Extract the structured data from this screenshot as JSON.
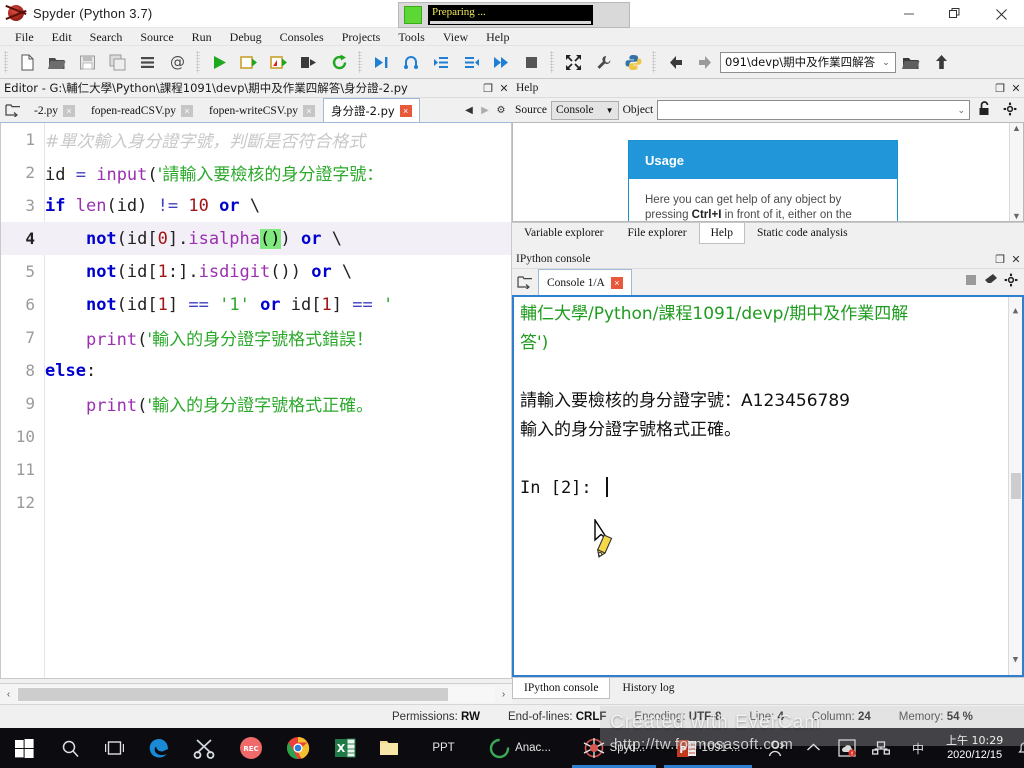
{
  "window": {
    "title": "Spyder (Python 3.7)",
    "app_icon": "spyder-logo-icon",
    "minimize": "—",
    "maximize": "❐",
    "close": "✕",
    "progress_widget": {
      "label": "Preparing ...",
      "indicator_color": "#5cd733"
    }
  },
  "menubar": {
    "items": [
      {
        "label": "File"
      },
      {
        "label": "Edit"
      },
      {
        "label": "Search"
      },
      {
        "label": "Source"
      },
      {
        "label": "Run"
      },
      {
        "label": "Debug"
      },
      {
        "label": "Consoles"
      },
      {
        "label": "Projects"
      },
      {
        "label": "Tools"
      },
      {
        "label": "View"
      },
      {
        "label": "Help"
      }
    ]
  },
  "toolbar": {
    "path_combo": {
      "value": "091\\devp\\期中及作業四解答",
      "arrow": "⌄"
    },
    "buttons": [
      {
        "name": "new-file-button",
        "icon": "new-file-icon"
      },
      {
        "name": "open-file-button",
        "icon": "open-folder-icon"
      },
      {
        "name": "save-file-button",
        "icon": "save-disk-icon"
      },
      {
        "name": "save-all-button",
        "icon": "save-all-icon"
      },
      {
        "name": "file-switcher-button",
        "icon": "list-icon"
      },
      {
        "name": "find-symbol-button",
        "icon": "at-sign-icon"
      },
      {
        "name": "run-file-button",
        "icon": "run-play-icon"
      },
      {
        "name": "run-cell-button",
        "icon": "run-cell-icon"
      },
      {
        "name": "run-cell-advance-button",
        "icon": "run-cell-advance-icon"
      },
      {
        "name": "run-selection-button",
        "icon": "run-selection-icon"
      },
      {
        "name": "restart-kernel-button",
        "icon": "restart-circle-icon"
      },
      {
        "name": "debug-file-button",
        "icon": "debug-step-icon"
      },
      {
        "name": "debug-step-button",
        "icon": "debug-into-icon"
      },
      {
        "name": "debug-step-over-button",
        "icon": "debug-over-icon"
      },
      {
        "name": "debug-step-return-button",
        "icon": "debug-return-icon"
      },
      {
        "name": "debug-continue-button",
        "icon": "debug-continue-icon"
      },
      {
        "name": "debug-stop-button",
        "icon": "debug-stop-icon"
      },
      {
        "name": "maximize-pane-button",
        "icon": "expand-arrows-icon"
      },
      {
        "name": "preferences-button",
        "icon": "wrench-icon"
      },
      {
        "name": "pythonpath-button",
        "icon": "python-logo-icon"
      },
      {
        "name": "back-button",
        "icon": "arrow-left-icon"
      },
      {
        "name": "forward-button",
        "icon": "arrow-right-icon"
      },
      {
        "name": "browse-dir-button",
        "icon": "open-folder-icon"
      },
      {
        "name": "parent-dir-button",
        "icon": "arrow-up-icon"
      }
    ]
  },
  "editor": {
    "pane_title": "Editor - G:\\輔仁大學\\Python\\課程1091\\devp\\期中及作業四解答\\身分證-2.py",
    "undock_glyph": "❐",
    "close_glyph": "✕",
    "tabs": [
      {
        "label": "-2.py",
        "active": false
      },
      {
        "label": "fopen-readCSV.py",
        "active": false
      },
      {
        "label": "fopen-writeCSV.py",
        "active": false
      },
      {
        "label": "身分證-2.py",
        "active": true
      }
    ],
    "tab_nav": {
      "prev": "◀",
      "next": "▶",
      "options": "⚙"
    },
    "current_line": 4,
    "lines": [
      {
        "no": "1",
        "tokens": [
          {
            "t": "#單次輸入身分證字號，判斷是否符合格式",
            "c": "comment"
          }
        ]
      },
      {
        "no": "2",
        "tokens": [
          {
            "t": "id ",
            "c": "plain"
          },
          {
            "t": "=",
            "c": "op"
          },
          {
            "t": " ",
            "c": "plain"
          },
          {
            "t": "input",
            "c": "bi"
          },
          {
            "t": "(",
            "c": "plain"
          },
          {
            "t": "'請輸入要檢核的身分證字號：",
            "c": "str"
          }
        ]
      },
      {
        "no": "3",
        "tokens": [
          {
            "t": "if",
            "c": "kw"
          },
          {
            "t": " ",
            "c": "plain"
          },
          {
            "t": "len",
            "c": "bi"
          },
          {
            "t": "(id) ",
            "c": "plain"
          },
          {
            "t": "!=",
            "c": "op"
          },
          {
            "t": " ",
            "c": "plain"
          },
          {
            "t": "10",
            "c": "num"
          },
          {
            "t": " ",
            "c": "plain"
          },
          {
            "t": "or",
            "c": "kw"
          },
          {
            "t": " \\",
            "c": "plain"
          }
        ]
      },
      {
        "no": "4",
        "tokens": [
          {
            "t": "    ",
            "c": "plain"
          },
          {
            "t": "not",
            "c": "kw"
          },
          {
            "t": "(id[",
            "c": "plain"
          },
          {
            "t": "0",
            "c": "num"
          },
          {
            "t": "].",
            "c": "plain"
          },
          {
            "t": "isalpha",
            "c": "bi"
          },
          {
            "t": "()",
            "c": "match"
          },
          {
            "t": ") ",
            "c": "plain"
          },
          {
            "t": "or",
            "c": "kw"
          },
          {
            "t": " \\",
            "c": "plain"
          }
        ]
      },
      {
        "no": "5",
        "tokens": [
          {
            "t": "    ",
            "c": "plain"
          },
          {
            "t": "not",
            "c": "kw"
          },
          {
            "t": "(id[",
            "c": "plain"
          },
          {
            "t": "1",
            "c": "num"
          },
          {
            "t": ":].",
            "c": "plain"
          },
          {
            "t": "isdigit",
            "c": "bi"
          },
          {
            "t": "()) ",
            "c": "plain"
          },
          {
            "t": "or",
            "c": "kw"
          },
          {
            "t": " \\",
            "c": "plain"
          }
        ]
      },
      {
        "no": "6",
        "tokens": [
          {
            "t": "    ",
            "c": "plain"
          },
          {
            "t": "not",
            "c": "kw"
          },
          {
            "t": "(id[",
            "c": "plain"
          },
          {
            "t": "1",
            "c": "num"
          },
          {
            "t": "] ",
            "c": "plain"
          },
          {
            "t": "==",
            "c": "op"
          },
          {
            "t": " ",
            "c": "plain"
          },
          {
            "t": "'1'",
            "c": "str"
          },
          {
            "t": " ",
            "c": "plain"
          },
          {
            "t": "or",
            "c": "kw"
          },
          {
            "t": " id[",
            "c": "plain"
          },
          {
            "t": "1",
            "c": "num"
          },
          {
            "t": "] ",
            "c": "plain"
          },
          {
            "t": "==",
            "c": "op"
          },
          {
            "t": " ",
            "c": "plain"
          },
          {
            "t": "'",
            "c": "str"
          }
        ]
      },
      {
        "no": "7",
        "tokens": [
          {
            "t": "    ",
            "c": "plain"
          },
          {
            "t": "print",
            "c": "bi"
          },
          {
            "t": "(",
            "c": "plain"
          },
          {
            "t": "'輸入的身分證字號格式錯誤！",
            "c": "str"
          }
        ]
      },
      {
        "no": "8",
        "tokens": [
          {
            "t": "else",
            "c": "kw"
          },
          {
            "t": ":",
            "c": "plain"
          }
        ]
      },
      {
        "no": "9",
        "tokens": [
          {
            "t": "    ",
            "c": "plain"
          },
          {
            "t": "print",
            "c": "bi"
          },
          {
            "t": "(",
            "c": "plain"
          },
          {
            "t": "'輸入的身分證字號格式正確。",
            "c": "str"
          }
        ]
      },
      {
        "no": "10",
        "tokens": []
      },
      {
        "no": "11",
        "tokens": []
      },
      {
        "no": "12",
        "tokens": []
      }
    ],
    "hscroll": {
      "left_arrow": "‹",
      "right_arrow": "›"
    }
  },
  "help": {
    "pane_title": "Help",
    "undock_glyph": "❐",
    "close_glyph": "✕",
    "source_label": "Source",
    "source_value": "Console",
    "source_arrow": "▼",
    "object_label": "Object",
    "object_value": "",
    "object_arrow": "⌄",
    "lock_icon": "unlock-icon",
    "options_icon": "gear-icon",
    "card": {
      "heading": "Usage",
      "line1": "Here you can get help of any object by",
      "line2_pre": "pressing ",
      "line2_bold": "Ctrl+I",
      "line2_post": " in front of it, either on the",
      "accent": "#2196d8"
    },
    "tabs": [
      {
        "label": "Variable explorer",
        "active": false
      },
      {
        "label": "File explorer",
        "active": false
      },
      {
        "label": "Help",
        "active": true
      },
      {
        "label": "Static code analysis",
        "active": false
      }
    ]
  },
  "console": {
    "pane_title": "IPython console",
    "undock_glyph": "❐",
    "close_glyph": "✕",
    "browse_icon": "new-console-icon",
    "tab_label": "Console 1/A",
    "tab_close": "✕",
    "right_buttons": [
      {
        "name": "stop-kernel-button",
        "icon": "stop-square-icon"
      },
      {
        "name": "remove-all-variables-button",
        "icon": "eraser-icon"
      },
      {
        "name": "console-options-button",
        "icon": "gear-icon"
      }
    ],
    "output": [
      {
        "type": "green",
        "text": "輔仁大學/Python/課程1091/devp/期中及作業四解"
      },
      {
        "type": "green",
        "text": "答')"
      },
      {
        "type": "blank",
        "text": ""
      },
      {
        "type": "black",
        "text": "請輸入要檢核的身分證字號：A123456789"
      },
      {
        "type": "black",
        "text": "輸入的身分證字號格式正確。"
      },
      {
        "type": "blank",
        "text": ""
      },
      {
        "type": "prompt",
        "text": "In [2]: "
      }
    ],
    "cursor_icon": "pencil-cursor",
    "tabs": [
      {
        "label": "IPython console",
        "active": true
      },
      {
        "label": "History log",
        "active": false
      }
    ]
  },
  "statusbar": {
    "items": [
      {
        "label": "Permissions:",
        "value": "RW"
      },
      {
        "label": "End-of-lines:",
        "value": "CRLF"
      },
      {
        "label": "Encoding:",
        "value": "UTF-8"
      },
      {
        "label": "Line:",
        "value": "4"
      },
      {
        "label": "Column:",
        "value": "24"
      },
      {
        "label": "Memory:",
        "value": "54 %"
      }
    ]
  },
  "watermark": {
    "line1": "Created with EverCam",
    "line2": "http://tw.formosasoft.com"
  },
  "taskbar": {
    "start_icon": "windows-start-icon",
    "search_icon": "search-icon",
    "taskview_icon": "task-view-icon",
    "items": [
      {
        "name": "edge",
        "icon": "edge-browser-icon",
        "label": ""
      },
      {
        "name": "snipping-tool",
        "icon": "scissors-icon",
        "label": ""
      },
      {
        "name": "recorder",
        "icon": "rec-circle-icon",
        "label": ""
      },
      {
        "name": "chrome",
        "icon": "chrome-browser-icon",
        "label": ""
      },
      {
        "name": "excel",
        "icon": "excel-icon",
        "label": ""
      },
      {
        "name": "folder",
        "icon": "folder-icon",
        "label": ""
      },
      {
        "name": "powerpoint-pinned",
        "icon": "ppt-icon",
        "label": "PPT"
      },
      {
        "name": "anaconda",
        "icon": "anaconda-icon",
        "label": "Anac..."
      },
      {
        "name": "spyder",
        "icon": "spyder-logo-icon",
        "label": "Spyd...",
        "active": true
      },
      {
        "name": "powerpoint-doc",
        "icon": "powerpoint-icon",
        "label": "1091-...",
        "active": true
      }
    ],
    "tray": [
      {
        "name": "people-icon"
      },
      {
        "name": "chevron-up-icon"
      },
      {
        "name": "onedrive-sync-icon"
      },
      {
        "name": "network-icon"
      },
      {
        "name": "ime-icon"
      },
      {
        "name": "speaker-icon"
      }
    ],
    "clock_time": "上午 10:29",
    "clock_date": "2020/12/15",
    "notification_icon": "notification-icon"
  }
}
